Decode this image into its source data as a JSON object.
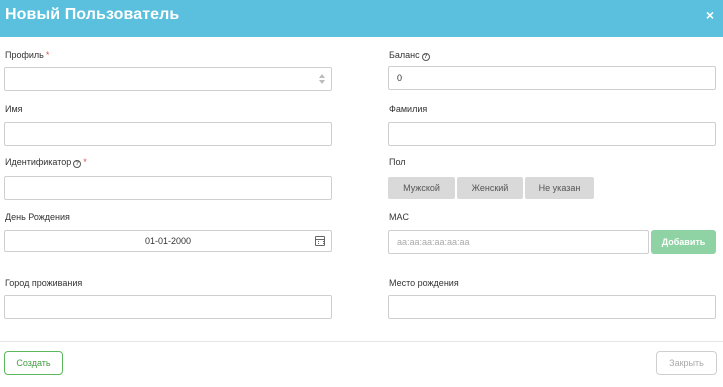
{
  "header": {
    "title": "Новый Пользователь",
    "close_glyph": "×"
  },
  "fields": {
    "profile": {
      "label": "Профиль",
      "required": "*",
      "value": ""
    },
    "balance": {
      "label": "Баланс",
      "value": "0",
      "help": "?"
    },
    "first_name": {
      "label": "Имя",
      "value": ""
    },
    "last_name": {
      "label": "Фамилия",
      "value": ""
    },
    "identifier": {
      "label": "Идентификатор",
      "required": "*",
      "help": "?",
      "value": ""
    },
    "gender": {
      "label": "Пол",
      "options": [
        "Мужской",
        "Женский",
        "Не указан"
      ]
    },
    "birthday": {
      "label": "День Рождения",
      "value": "01-01-2000"
    },
    "mac": {
      "label": "MAC",
      "placeholder": "aa:aa:aa:aa:aa:aa",
      "add_label": "Добавить"
    },
    "city": {
      "label": "Город проживания",
      "value": ""
    },
    "birthplace": {
      "label": "Место рождения",
      "value": ""
    }
  },
  "footer": {
    "create_label": "Создать",
    "close_label": "Закрыть"
  },
  "colors": {
    "header": "#5bc0de",
    "required": "#d9534f",
    "create": "#5cb85c",
    "add": "#8fd3a4"
  },
  "icons": {
    "profile_select": "select-arrows-icon",
    "birthday": "calendar-icon",
    "help": "help-circle-icon"
  }
}
